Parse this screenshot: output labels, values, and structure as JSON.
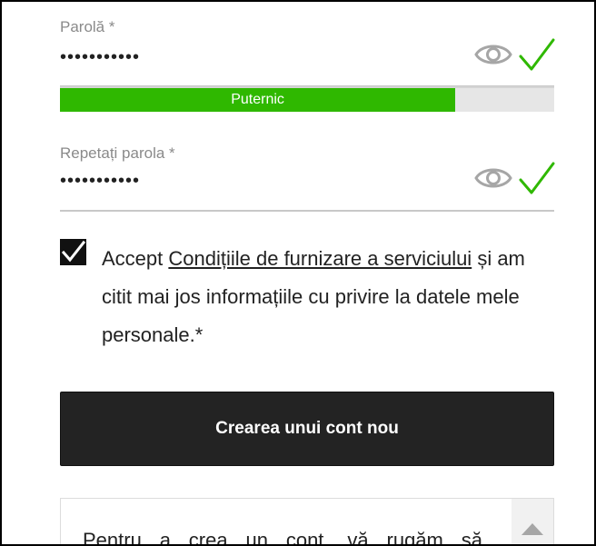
{
  "password_field": {
    "label": "Parolă *",
    "value": "•••••••••••",
    "show_icon": "eye-icon",
    "valid_icon": "checkmark-icon"
  },
  "strength": {
    "label": "Puternic",
    "level": 0.8,
    "color": "#2fb800"
  },
  "repeat_field": {
    "label": "Repetați parola *",
    "value": "•••••••••••",
    "show_icon": "eye-icon",
    "valid_icon": "checkmark-icon"
  },
  "consent": {
    "checked": true,
    "text_before": "Accept ",
    "link_text": "Condițiile de furnizare a serviciului",
    "text_after": " și am citit mai jos informațiile cu privire la datele mele personale.*"
  },
  "create_button": {
    "label": "Crearea unui cont nou",
    "color": "#232323"
  },
  "info_box": {
    "text": "Pentru a crea un cont, vă rugăm să"
  },
  "colors": {
    "accent_green": "#2fb800",
    "check_green": "#2fb800",
    "button_dark": "#232323"
  }
}
